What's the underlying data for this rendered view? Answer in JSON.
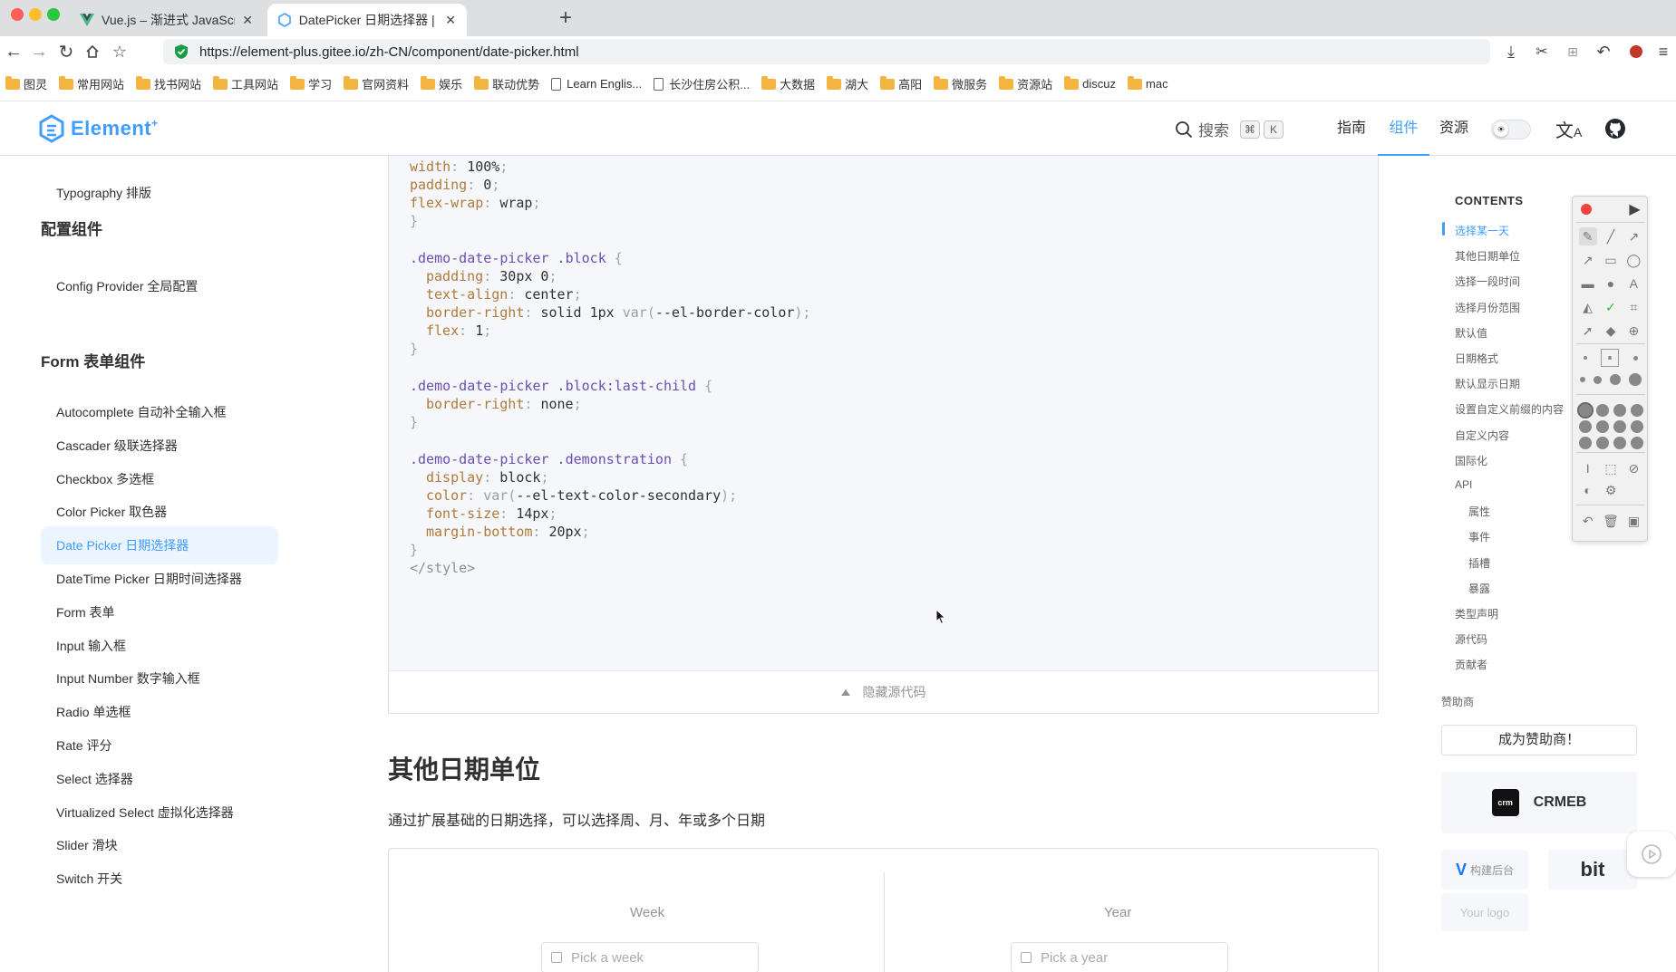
{
  "browser": {
    "tabs": [
      {
        "title": "Vue.js – 渐进式 JavaScript 框...",
        "close": "✕",
        "active": false
      },
      {
        "title": "DatePicker 日期选择器 | Eleme...",
        "close": "✕",
        "active": true
      }
    ],
    "new_tab": "+",
    "url": "https://element-plus.gitee.io/zh-CN/component/date-picker.html",
    "bookmarks": [
      {
        "label": "图灵",
        "icon": "folder-icon"
      },
      {
        "label": "常用网站",
        "icon": "folder-icon"
      },
      {
        "label": "找书网站",
        "icon": "folder-icon"
      },
      {
        "label": "工具网站",
        "icon": "folder-icon"
      },
      {
        "label": "学习",
        "icon": "folder-icon"
      },
      {
        "label": "官网资料",
        "icon": "folder-icon"
      },
      {
        "label": "娱乐",
        "icon": "folder-icon"
      },
      {
        "label": "联动优势",
        "icon": "folder-icon"
      },
      {
        "label": "Learn Englis...",
        "icon": "page-icon"
      },
      {
        "label": "长沙住房公积...",
        "icon": "page-icon"
      },
      {
        "label": "大数据",
        "icon": "folder-icon"
      },
      {
        "label": "湖大",
        "icon": "folder-icon"
      },
      {
        "label": "高阳",
        "icon": "folder-icon"
      },
      {
        "label": "微服务",
        "icon": "folder-icon"
      },
      {
        "label": "资源站",
        "icon": "folder-icon"
      },
      {
        "label": "discuz",
        "icon": "folder-icon"
      },
      {
        "label": "mac",
        "icon": "folder-icon"
      }
    ]
  },
  "header": {
    "logo_text": "Element",
    "logo_plus": "+",
    "search_label": "搜索",
    "kbd_cmd": "⌘",
    "kbd_k": "K",
    "nav": [
      "指南",
      "组件",
      "资源"
    ],
    "active_nav": "组件",
    "theme_switch_icon": "sun-icon",
    "colors": {
      "brand": "#409eff"
    }
  },
  "sidebar": {
    "typography": "Typography 排版",
    "group_config": "配置组件",
    "config_provider": "Config Provider 全局配置",
    "group_form": "Form 表单组件",
    "items": [
      "Autocomplete 自动补全输入框",
      "Cascader 级联选择器",
      "Checkbox 多选框",
      "Color Picker 取色器",
      "Date Picker 日期选择器",
      "DateTime Picker 日期时间选择器",
      "Form 表单",
      "Input 输入框",
      "Input Number 数字输入框",
      "Radio 单选框",
      "Rate 评分",
      "Select 选择器",
      "Virtualized Select 虚拟化选择器",
      "Slider 滑块",
      "Switch 开关"
    ],
    "active_item": "Date Picker 日期选择器"
  },
  "code": {
    "l1_prop": "width",
    "l1_val": "100%",
    "l2_prop": "padding",
    "l2_val": "0",
    "l3_prop": "flex-wrap",
    "l3_val": "wrap",
    "close": "}",
    "open": "{",
    "sel_block": ".demo-date-picker .block",
    "b_p1": "padding",
    "b_v1": "30px 0",
    "b_p2": "text-align",
    "b_v2": "center",
    "b_p3": "border-right",
    "b_v3a": "solid 1px ",
    "b_v3fn": "var",
    "b_v3arg": "--el-border-color",
    "b_p4": "flex",
    "b_v4": "1",
    "sel_last": ".demo-date-picker .block:last-child",
    "l_p1": "border-right",
    "l_v1": "none",
    "sel_demo": ".demo-date-picker .demonstration",
    "d_p1": "display",
    "d_v1": "block",
    "d_p2": "color",
    "d_v2fn": "var",
    "d_v2arg": "--el-text-color-secondary",
    "d_p3": "font-size",
    "d_v3": "14px",
    "d_p4": "margin-bottom",
    "d_v4": "20px",
    "end_tag": "</style>"
  },
  "hide_code_label": "隐藏源代码",
  "section": {
    "title": "其他日期单位",
    "desc": "通过扩展基础的日期选择，可以选择周、月、年或多个日期"
  },
  "demo": {
    "week_label": "Week",
    "week_placeholder": "Pick a week",
    "year_label": "Year",
    "year_placeholder": "Pick a year"
  },
  "toc": {
    "title": "CONTENTS",
    "items": [
      {
        "label": "选择某一天",
        "sub": false
      },
      {
        "label": "其他日期单位",
        "sub": false
      },
      {
        "label": "选择一段时间",
        "sub": false
      },
      {
        "label": "选择月份范围",
        "sub": false
      },
      {
        "label": "默认值",
        "sub": false
      },
      {
        "label": "日期格式",
        "sub": false
      },
      {
        "label": "默认显示日期",
        "sub": false
      },
      {
        "label": "设置自定义前缀的内容",
        "sub": false
      },
      {
        "label": "自定义内容",
        "sub": false
      },
      {
        "label": "国际化",
        "sub": false
      },
      {
        "label": "API",
        "sub": false
      },
      {
        "label": "属性",
        "sub": true
      },
      {
        "label": "事件",
        "sub": true
      },
      {
        "label": "插槽",
        "sub": true
      },
      {
        "label": "暴露",
        "sub": true
      },
      {
        "label": "类型声明",
        "sub": false
      },
      {
        "label": "源代码",
        "sub": false
      },
      {
        "label": "贡献者",
        "sub": false
      }
    ],
    "active": "选择某一天"
  },
  "sponsors": {
    "heading": "赞助商",
    "become": "成为赞助商！",
    "crmeb": "CRMEB",
    "vform": "构建后台",
    "bit": "bit",
    "your_logo": "Your logo"
  }
}
